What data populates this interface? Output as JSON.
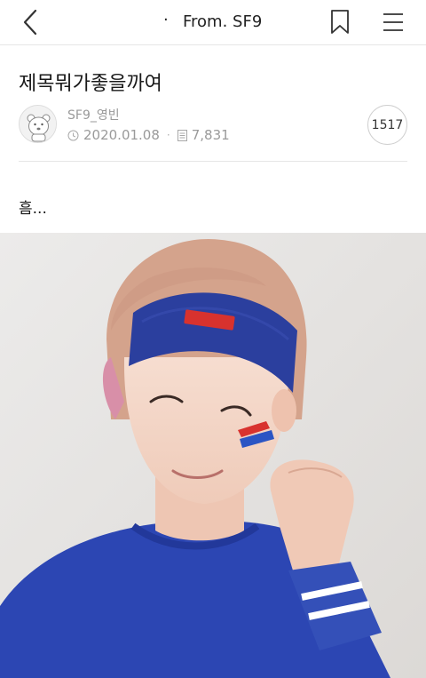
{
  "header": {
    "title_dot": "·",
    "title": "From. SF9",
    "icons": {
      "back": "chevron-left-icon",
      "bookmark": "bookmark-icon",
      "menu": "menu-icon"
    }
  },
  "post": {
    "title": "제목뭐가좋을까여",
    "author": "SF9_영빈",
    "date": "2020.01.08",
    "meta_separator": "·",
    "views": "7,831",
    "comment_count": "1517",
    "body": "흠..."
  },
  "colors": {
    "divider": "#e6e6e6",
    "meta_text": "#9a9a9a",
    "headband": "#2b3f9e",
    "shirt": "#2c46b3"
  }
}
